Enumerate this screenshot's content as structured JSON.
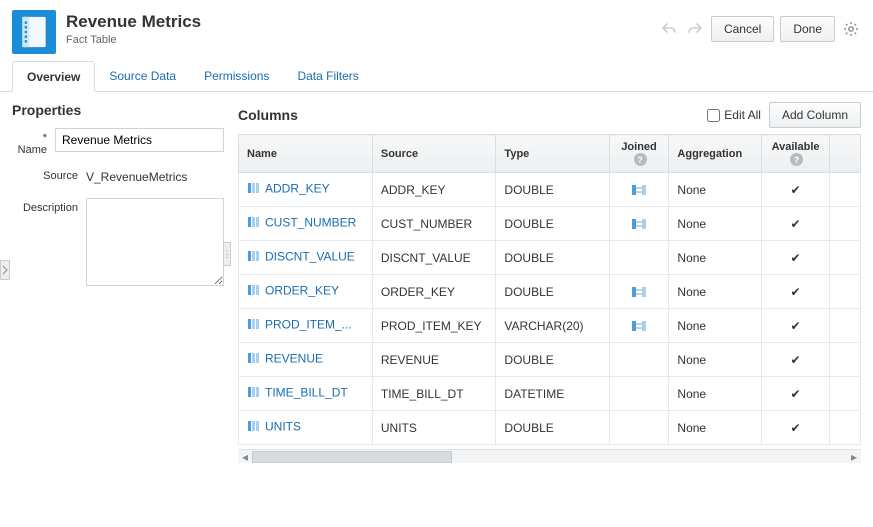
{
  "header": {
    "title": "Revenue Metrics",
    "subtitle": "Fact Table",
    "cancel": "Cancel",
    "done": "Done"
  },
  "tabs": [
    {
      "label": "Overview",
      "active": true
    },
    {
      "label": "Source Data",
      "active": false
    },
    {
      "label": "Permissions",
      "active": false
    },
    {
      "label": "Data Filters",
      "active": false
    }
  ],
  "properties": {
    "heading": "Properties",
    "name_label": "* Name",
    "name_value": "Revenue Metrics",
    "source_label": "Source",
    "source_value": "V_RevenueMetrics",
    "description_label": "Description",
    "description_value": ""
  },
  "columns": {
    "heading": "Columns",
    "edit_all_label": "Edit All",
    "add_column_label": "Add Column",
    "headers": {
      "name": "Name",
      "source": "Source",
      "type": "Type",
      "joined": "Joined",
      "aggregation": "Aggregation",
      "available": "Available"
    },
    "rows": [
      {
        "name": "ADDR_KEY",
        "source": "ADDR_KEY",
        "type": "DOUBLE",
        "joined": true,
        "aggregation": "None",
        "available": true
      },
      {
        "name": "CUST_NUMBER",
        "source": "CUST_NUMBER",
        "type": "DOUBLE",
        "joined": true,
        "aggregation": "None",
        "available": true
      },
      {
        "name": "DISCNT_VALUE",
        "source": "DISCNT_VALUE",
        "type": "DOUBLE",
        "joined": false,
        "aggregation": "None",
        "available": true
      },
      {
        "name": "ORDER_KEY",
        "source": "ORDER_KEY",
        "type": "DOUBLE",
        "joined": true,
        "aggregation": "None",
        "available": true
      },
      {
        "name": "PROD_ITEM_...",
        "source": "PROD_ITEM_KEY",
        "type": "VARCHAR(20)",
        "joined": true,
        "aggregation": "None",
        "available": true
      },
      {
        "name": "REVENUE",
        "source": "REVENUE",
        "type": "DOUBLE",
        "joined": false,
        "aggregation": "None",
        "available": true
      },
      {
        "name": "TIME_BILL_DT",
        "source": "TIME_BILL_DT",
        "type": "DATETIME",
        "joined": false,
        "aggregation": "None",
        "available": true
      },
      {
        "name": "UNITS",
        "source": "UNITS",
        "type": "DOUBLE",
        "joined": false,
        "aggregation": "None",
        "available": true
      }
    ]
  }
}
